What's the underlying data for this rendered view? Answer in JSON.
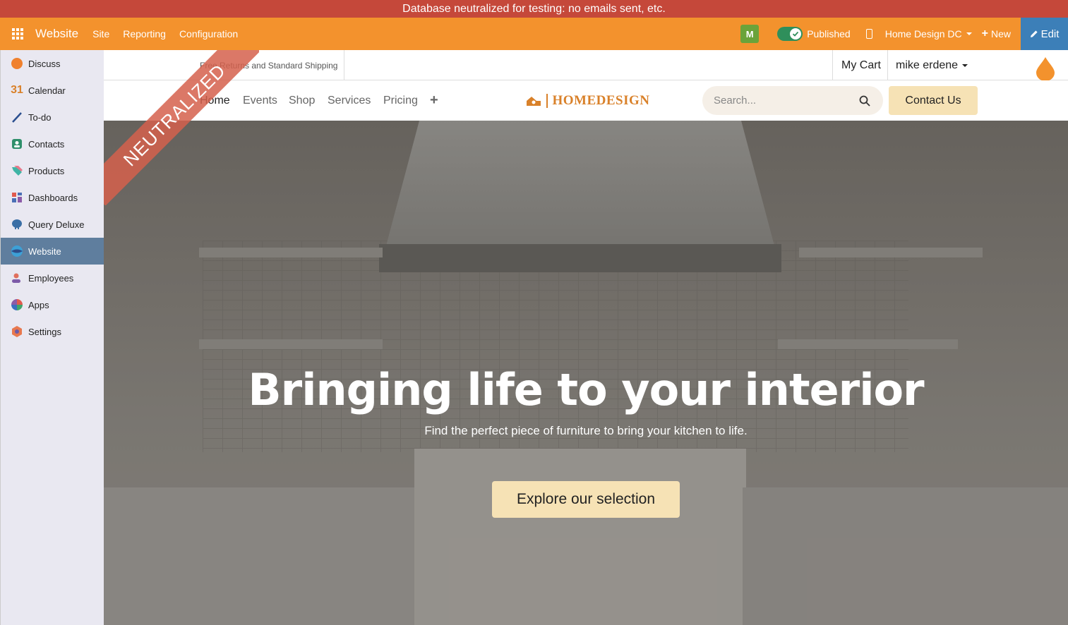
{
  "banner": {
    "text": "Database neutralized for testing: no emails sent, etc."
  },
  "navbar": {
    "brand": "Website",
    "menus": [
      "Site",
      "Reporting",
      "Configuration"
    ],
    "avatar_letter": "M",
    "published_label": "Published",
    "website_selector": "Home Design DC",
    "new_label": "New",
    "edit_label": "Edit"
  },
  "sidebar": {
    "items": [
      {
        "label": "Discuss",
        "icon": "discuss-icon"
      },
      {
        "label": "Calendar",
        "icon": "calendar-icon"
      },
      {
        "label": "To-do",
        "icon": "todo-icon"
      },
      {
        "label": "Contacts",
        "icon": "contacts-icon"
      },
      {
        "label": "Products",
        "icon": "products-icon"
      },
      {
        "label": "Dashboards",
        "icon": "dashboards-icon"
      },
      {
        "label": "Query Deluxe",
        "icon": "query-deluxe-icon"
      },
      {
        "label": "Website",
        "icon": "website-icon",
        "active": true
      },
      {
        "label": "Employees",
        "icon": "employees-icon"
      },
      {
        "label": "Apps",
        "icon": "apps-icon"
      },
      {
        "label": "Settings",
        "icon": "settings-icon"
      }
    ]
  },
  "site": {
    "promo": "Free Returns and Standard Shipping",
    "cart": "My Cart",
    "user": "mike erdene",
    "menu": [
      "Home",
      "Events",
      "Shop",
      "Services",
      "Pricing"
    ],
    "logo_text": "HOMEDESIGN",
    "search_placeholder": "Search...",
    "contact_label": "Contact Us",
    "ribbon": "NEUTRALIZED"
  },
  "hero": {
    "title": "Bringing life to your interior",
    "subtitle": "Find the perfect piece of furniture to bring your kitchen to life.",
    "cta": "Explore our selection"
  },
  "colors": {
    "banner": "#c5483a",
    "navbar": "#f3922d",
    "edit": "#3c7fb8",
    "sidebar_active": "#5f7e9e",
    "accent_button": "#f6e2b5",
    "logo": "#d9812a"
  }
}
